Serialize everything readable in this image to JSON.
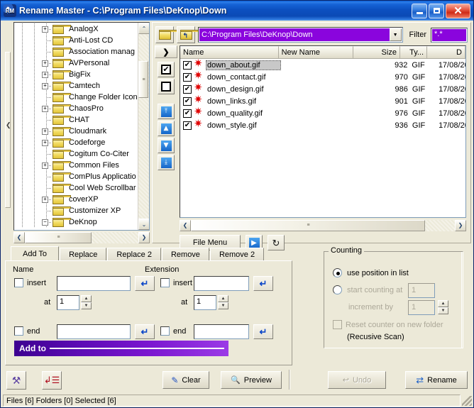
{
  "window": {
    "title": "Rename Master - C:\\Program Files\\DeKnop\\Down",
    "icon_label": "RM",
    "minimize_label": "Minimize",
    "maximize_label": "Maximize",
    "close_label": "✕"
  },
  "tree": {
    "items": [
      {
        "label": "AnalogX",
        "expander": "+"
      },
      {
        "label": "Anti-Lost CD",
        "expander": ""
      },
      {
        "label": "Association manag",
        "expander": ""
      },
      {
        "label": "AVPersonal",
        "expander": "+"
      },
      {
        "label": "BigFix",
        "expander": "+"
      },
      {
        "label": "Camtech",
        "expander": "+"
      },
      {
        "label": "Change Folder Icon",
        "expander": ""
      },
      {
        "label": "ChaosPro",
        "expander": "+"
      },
      {
        "label": "CHAT",
        "expander": ""
      },
      {
        "label": "Cloudmark",
        "expander": "+"
      },
      {
        "label": "Codeforge",
        "expander": "+"
      },
      {
        "label": "Cogitum Co-Citer",
        "expander": ""
      },
      {
        "label": "Common Files",
        "expander": "+"
      },
      {
        "label": "ComPlus Applicatio",
        "expander": ""
      },
      {
        "label": "Cool Web Scrollbar",
        "expander": ""
      },
      {
        "label": "coverXP",
        "expander": "+"
      },
      {
        "label": "Customizer XP",
        "expander": ""
      },
      {
        "label": "DeKnop",
        "expander": "−"
      }
    ],
    "scroll_up": "⌃",
    "scroll_down": "⌄",
    "scroll_left": "❮",
    "scroll_right": "❯",
    "thumb_grip": "≡"
  },
  "path": {
    "new_folder_icon": "folder-icon",
    "up_folder_icon": "folder-up-icon",
    "value": "C:\\Program Files\\DeKnop\\Down",
    "dropdown_glyph": "▼",
    "filter_label": "Filter",
    "filter_value": "*.*"
  },
  "navcolumn": {
    "header": "❯",
    "check_all": "✔",
    "uncheck_all": "",
    "move_top": "⤒",
    "move_up": "▲",
    "move_down": "▼",
    "move_bottom": "⤓"
  },
  "filelist": {
    "columns": [
      {
        "label": "Name"
      },
      {
        "label": "New Name"
      },
      {
        "label": "Size"
      },
      {
        "label": "Ty..."
      },
      {
        "label": "D"
      }
    ],
    "rows": [
      {
        "checked": "✔",
        "name": "down_about.gif",
        "new_name": "",
        "size": "932",
        "type": "GIF",
        "date": "17/08/20",
        "selected": true
      },
      {
        "checked": "✔",
        "name": "down_contact.gif",
        "new_name": "",
        "size": "970",
        "type": "GIF",
        "date": "17/08/20",
        "selected": false
      },
      {
        "checked": "✔",
        "name": "down_design.gif",
        "new_name": "",
        "size": "986",
        "type": "GIF",
        "date": "17/08/20",
        "selected": false
      },
      {
        "checked": "✔",
        "name": "down_links.gif",
        "new_name": "",
        "size": "901",
        "type": "GIF",
        "date": "17/08/20",
        "selected": false
      },
      {
        "checked": "✔",
        "name": "down_quality.gif",
        "new_name": "",
        "size": "976",
        "type": "GIF",
        "date": "17/08/20",
        "selected": false
      },
      {
        "checked": "✔",
        "name": "down_style.gif",
        "new_name": "",
        "size": "936",
        "type": "GIF",
        "date": "17/08/20",
        "selected": false
      }
    ],
    "file_menu_label": "File Menu",
    "go_icon": "▶",
    "refresh_icon": "↻"
  },
  "tabs": [
    {
      "label": "Add To",
      "active": true
    },
    {
      "label": "Replace",
      "active": false
    },
    {
      "label": "Replace 2",
      "active": false
    },
    {
      "label": "Remove",
      "active": false
    },
    {
      "label": "Remove 2",
      "active": false
    }
  ],
  "addto": {
    "name_group": "Name",
    "extension_group": "Extension",
    "insert_label": "insert",
    "at_label": "at",
    "end_label": "end",
    "name_insert_value": "",
    "name_at_value": "1",
    "name_end_value": "",
    "ext_insert_value": "",
    "ext_at_value": "1",
    "ext_end_value": "",
    "enter_glyph": "↵",
    "spin_up": "▲",
    "spin_down": "▼",
    "banner_label": "Add to"
  },
  "counting": {
    "title": "Counting",
    "option_position": "use position in list",
    "option_start": "start counting at",
    "start_value": "1",
    "increment_label": "increment by",
    "increment_value": "1",
    "reset_label": "Reset counter on new folder",
    "recursive_label": "(Recusive Scan)",
    "spin_up": "▲",
    "spin_down": "▼"
  },
  "bottom": {
    "tools_icon": "tools-hammer-icon",
    "script_icon": "script-list-icon",
    "clear_label": "Clear",
    "clear_icon": "✎",
    "preview_label": "Preview",
    "preview_icon": "🔍",
    "undo_label": "Undo",
    "undo_icon": "↩",
    "rename_label": "Rename",
    "rename_icon": "⇄"
  },
  "status": {
    "text": "Files [6] Folders [0] Selected [6]"
  }
}
